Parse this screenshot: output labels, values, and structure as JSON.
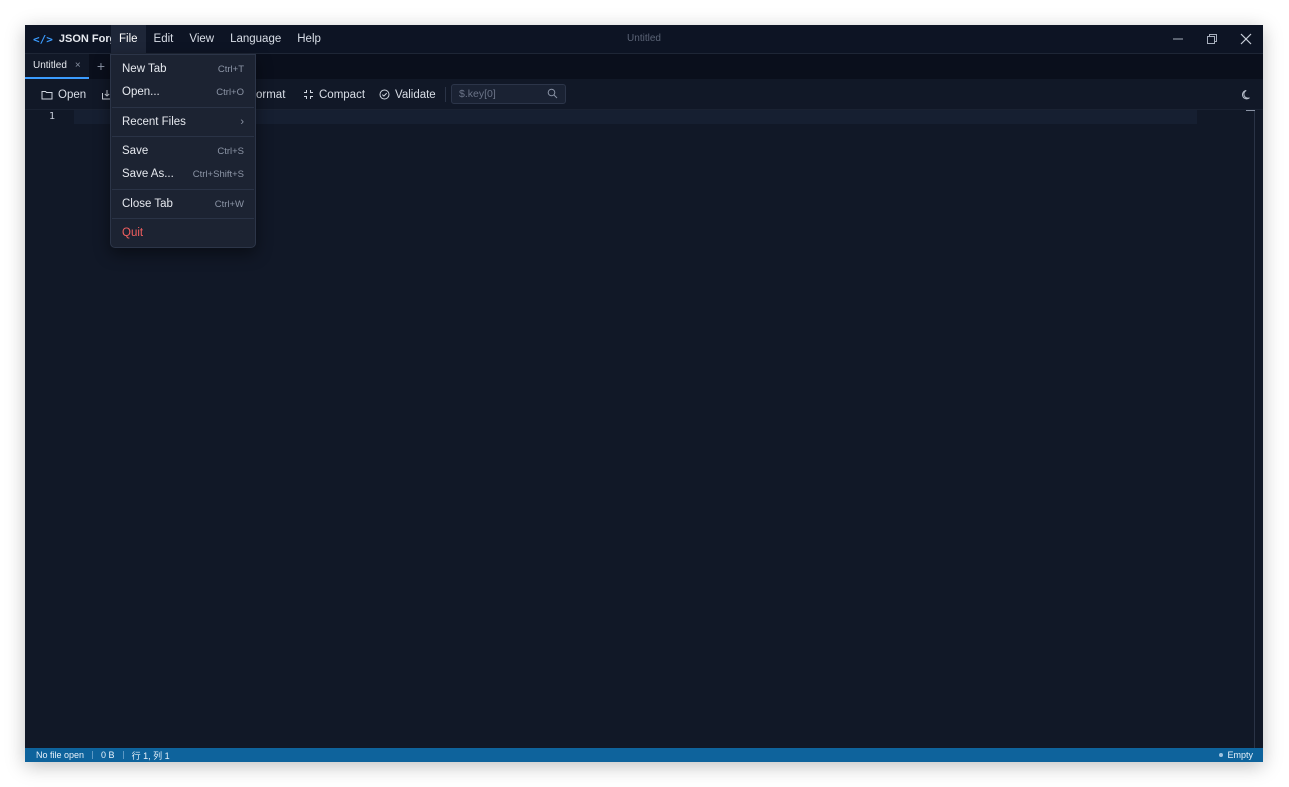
{
  "app": {
    "name": "JSON Forge",
    "icon": "code-brackets-icon",
    "window_title": "Untitled"
  },
  "menubar": {
    "items": [
      "File",
      "Edit",
      "View",
      "Language",
      "Help"
    ],
    "active": "File"
  },
  "window_controls": [
    "minimize-icon",
    "maximize-icon",
    "close-icon"
  ],
  "tabs": {
    "items": [
      {
        "label": "Untitled",
        "close": "×"
      }
    ],
    "add": "+"
  },
  "toolbar": {
    "open_label": "Open",
    "format_label": "ormat",
    "compact_label": "Compact",
    "validate_label": "Validate",
    "search": {
      "placeholder": "$.key[0]",
      "value": ""
    }
  },
  "editor": {
    "line_numbers": [
      "1"
    ]
  },
  "file_menu": {
    "items": [
      {
        "label": "New Tab",
        "shortcut": "Ctrl+T"
      },
      {
        "label": "Open...",
        "shortcut": "Ctrl+O"
      },
      {
        "label": "Recent Files",
        "shortcut": "›"
      },
      {
        "label": "Save",
        "shortcut": "Ctrl+S"
      },
      {
        "label": "Save As...",
        "shortcut": "Ctrl+Shift+S"
      },
      {
        "label": "Close Tab",
        "shortcut": "Ctrl+W"
      },
      {
        "label": "Quit",
        "shortcut": ""
      }
    ]
  },
  "statusbar": {
    "file": "No file open",
    "size": "0 B",
    "position": "行 1, 列 1",
    "state": "Empty"
  },
  "colors": {
    "accent": "#3b9cff",
    "statusbar": "#0e639c",
    "danger": "#f25f5f",
    "editor_bg": "#111827"
  }
}
